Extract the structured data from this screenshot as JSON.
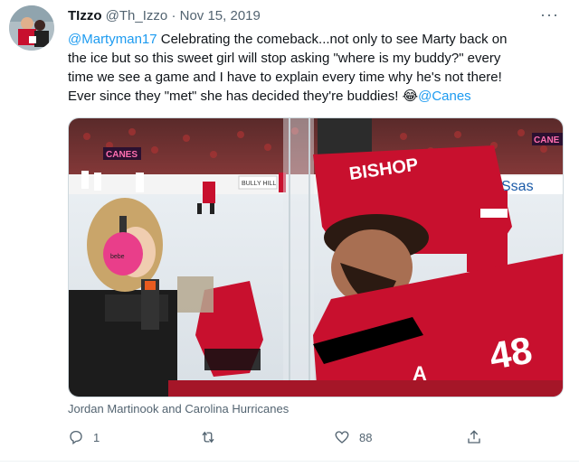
{
  "tweet": {
    "author_name": "TIzzo",
    "handle": "@Th_Izzo",
    "separator": "·",
    "date": "Nov 15, 2019",
    "more": "···",
    "mention": "@Martyman17",
    "body_line1": " Celebrating the comeback...not only to see Marty back on",
    "body_line2": "the ice but so this sweet girl will stop asking \"where is my buddy?\" every",
    "body_line3": "time we see a game and I have to explain every time why he's not there!",
    "body_line4": "Ever since they \"met\" she has decided they're buddies! ",
    "emoji": "😂",
    "hashtag_link": "@Canes",
    "caption": "Jordan Martinook and Carolina Hurricanes"
  },
  "photo": {
    "board_left": "CANES",
    "board_right": "CANE",
    "ad_sas": "Ssas",
    "ad_bully": "BULLY HILL",
    "jersey_name": "BISHOP",
    "jersey_number": "48",
    "sleeve_letter": "A",
    "headphone_text": "bebe"
  },
  "actions": {
    "reply_count": "1",
    "retweet_count": "",
    "like_count": "88"
  },
  "colors": {
    "link": "#1d9bf0",
    "jersey_red": "#c8102e",
    "headphones_pink": "#e93e8a",
    "text_secondary": "#536471"
  }
}
